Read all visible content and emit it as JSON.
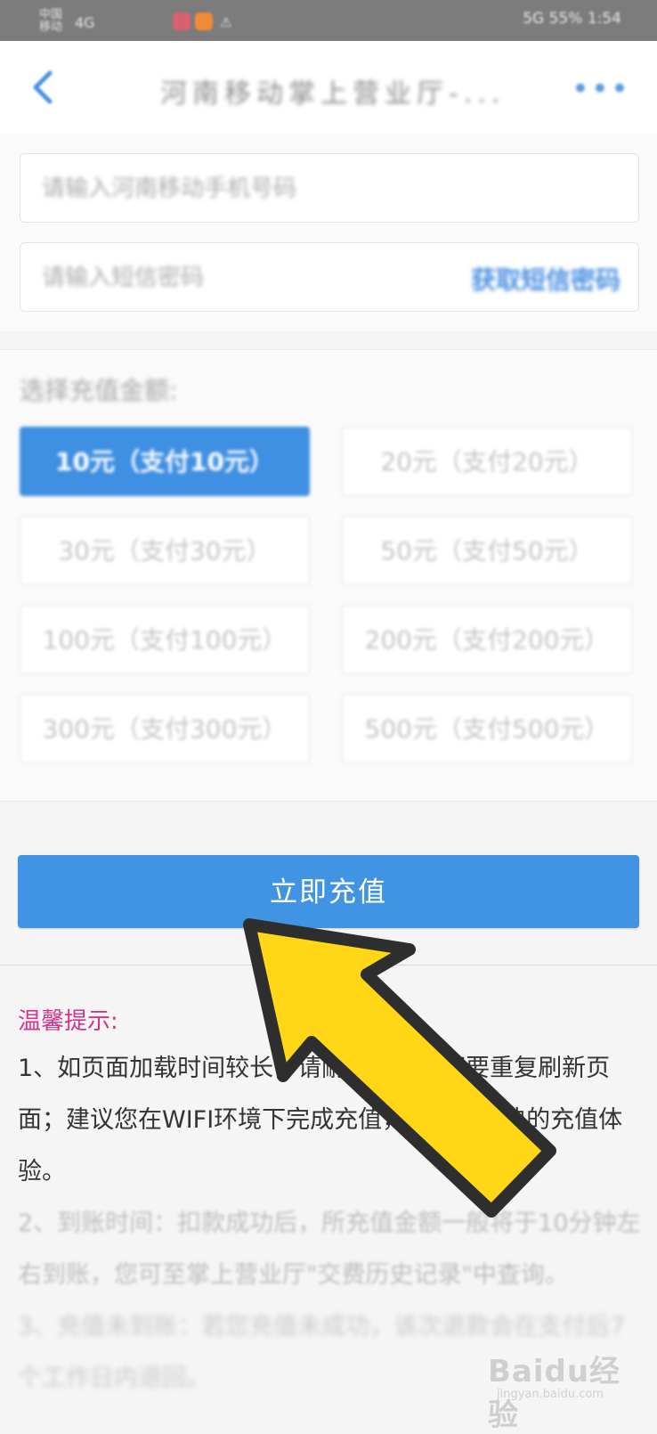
{
  "status_bar": {
    "carrier": "中国移动",
    "signal": "4G",
    "right_text": "5G 55% 1:54"
  },
  "nav": {
    "title": "河南移动掌上营业厅-...",
    "more_label": "•••"
  },
  "form": {
    "phone_placeholder": "请输入河南移动手机号码",
    "sms_placeholder": "请输入短信密码",
    "sms_link": "获取短信密码"
  },
  "amounts": {
    "label": "选择充值金额:",
    "options": [
      "10元（支付10元）",
      "20元（支付20元）",
      "30元（支付30元）",
      "50元（支付50元）",
      "100元（支付100元）",
      "200元（支付200元）",
      "300元（支付300元）",
      "500元（支付500元）"
    ],
    "selected": "10元（支付10元）"
  },
  "action": {
    "recharge_label": "立即充值"
  },
  "tips": {
    "title": "温馨提示:",
    "items": [
      "1、如页面加载时间较长，请耐心等待，不要重复刷新页面；建议您在WIFI环境下完成充值，以获得更快的充值体验。",
      "2、到账时间：扣款成功后，所充值金额一般将于10分钟左右到账，您可至掌上营业厅\"交费历史记录\"中查询。",
      "3、充值未到账：若您充值未成功，该次退款会在支付后7个工作日内退回。"
    ]
  },
  "watermark": {
    "text": "Baidu经验",
    "sub": "jingyan.baidu.com"
  },
  "colors": {
    "primary": "#4194e3",
    "tip_title": "#d6338a",
    "arrow": "#ffd716"
  }
}
